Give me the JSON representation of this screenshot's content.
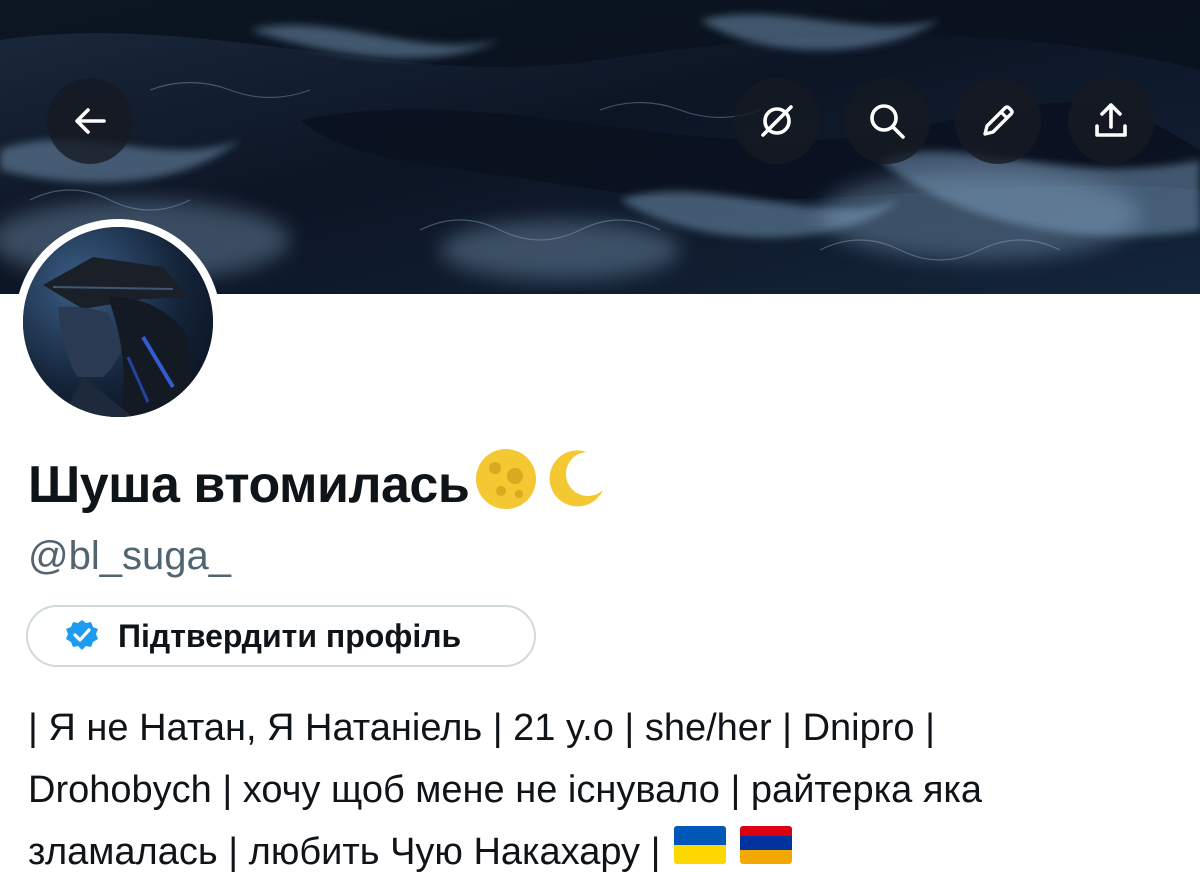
{
  "profile": {
    "display_name": "Шуша втомилась",
    "name_emojis": [
      "full-moon-emoji",
      "crescent-moon-emoji"
    ],
    "handle": "@bl_suga_",
    "verify_button_label": "Підтвердити профіль",
    "bio_lines": [
      "| Я не Натан, Я Натаніель | 21 y.o | she/her | Dnipro |",
      "Drohobych | хочу щоб мене не існувало | райтерка яка",
      "зламалась | любить Чую Накахару |"
    ],
    "bio_flags": [
      "ukraine-flag",
      "armenia-flag"
    ]
  },
  "header": {
    "buttons": [
      {
        "name": "back-button",
        "icon": "arrow-left-icon"
      },
      {
        "name": "grok-button",
        "icon": "slashed-circle-icon"
      },
      {
        "name": "search-button",
        "icon": "search-icon"
      },
      {
        "name": "edit-button",
        "icon": "pencil-icon"
      },
      {
        "name": "share-button",
        "icon": "share-icon"
      }
    ]
  },
  "colors": {
    "text_primary": "#0f1419",
    "text_secondary": "#536471",
    "verified_blue": "#1d9bf0",
    "pill_border": "#cfd9de",
    "banner_base": "#0d1626",
    "moon_yellow": "#f3c832",
    "flag_ua_blue": "#0057b7",
    "flag_ua_yellow": "#ffd700",
    "flag_am_red": "#d90012",
    "flag_am_blue": "#0033a0",
    "flag_am_orange": "#f2a800"
  }
}
